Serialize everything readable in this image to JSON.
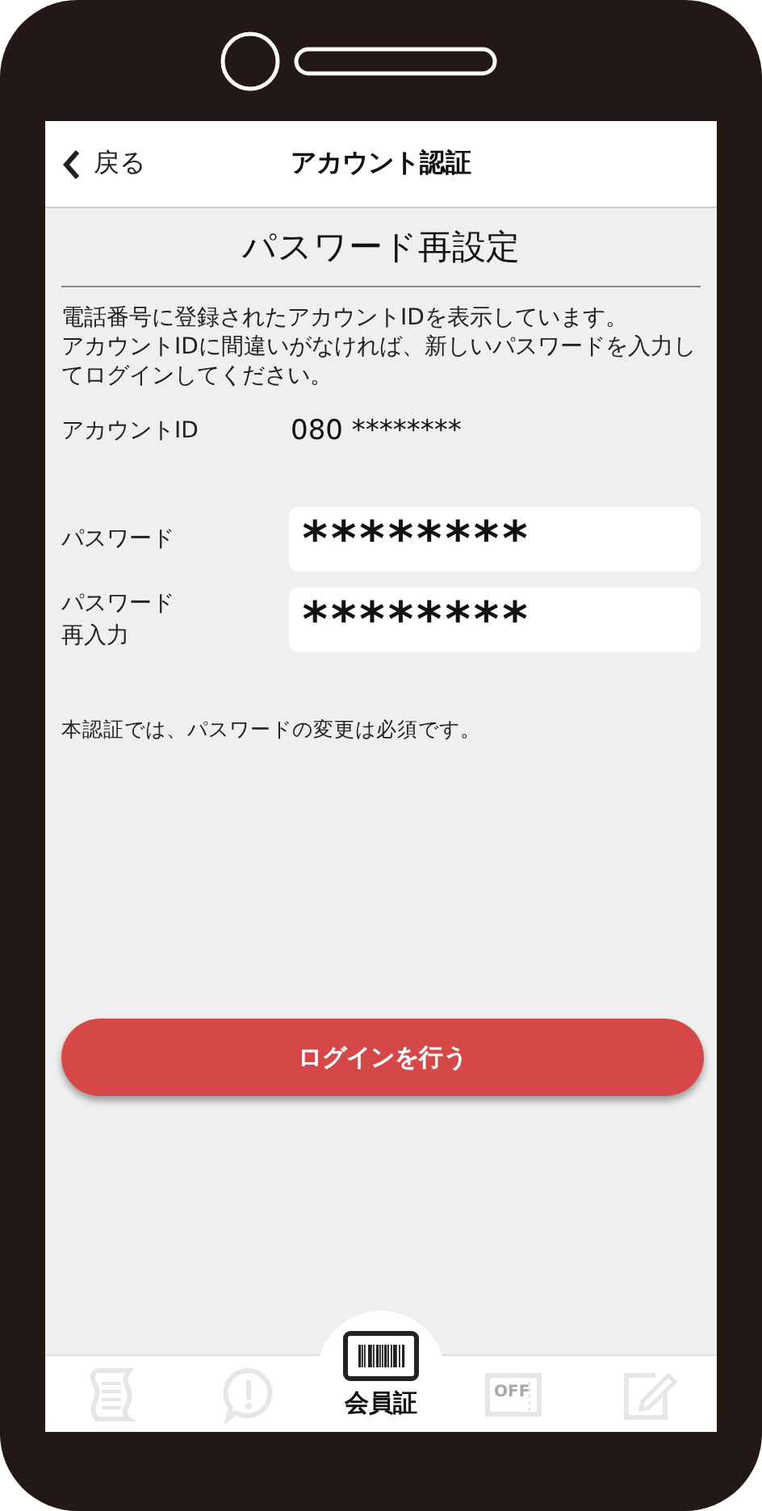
{
  "header": {
    "back": "戻る",
    "title": "アカウント認証"
  },
  "heading": "パスワード再設定",
  "description": [
    "電話番号に登録されたアカウントIDを表示しています。",
    "アカウントIDに間違いがなければ、新しいパスワードを入力してログインしてください。"
  ],
  "account": {
    "label": "アカウントID",
    "value": "080 ********"
  },
  "fields": [
    {
      "label": "パスワード",
      "value": "********"
    },
    {
      "label": "パスワード再入力",
      "value": "********"
    }
  ],
  "note": "本認証では、パスワードの変更は必須です。",
  "login_button": "ログインを行う",
  "tabs": [
    {
      "kind": "receipt",
      "selected": false
    },
    {
      "kind": "notice",
      "selected": false
    },
    {
      "kind": "card",
      "label": "会員証",
      "selected": true
    },
    {
      "kind": "coupon",
      "icon_text": "OFF",
      "selected": false
    },
    {
      "kind": "survey",
      "selected": false
    }
  ]
}
